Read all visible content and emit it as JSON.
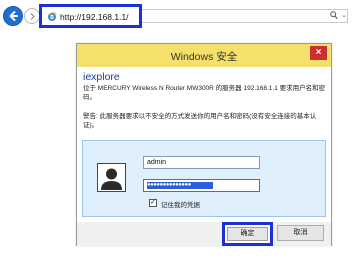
{
  "browser": {
    "url": "http://192.168.1.1/",
    "search_dropdown": "⌄",
    "icons": {
      "back": "back-arrow-icon",
      "forward": "forward-arrow-icon",
      "site": "ie-logo-icon",
      "search": "search-icon"
    },
    "colors": {
      "back_button": "#1f6fd1",
      "highlight_box": "#1d30d8"
    }
  },
  "dialog": {
    "title": "Windows 安全",
    "close_label": "×",
    "heading": "iexplore",
    "message": "位于 MERCURY Wireless N Router MW300R 的服务器 192.168.1.1 要求用户名和密码。",
    "warning": "警告: 此服务器要求以不安全的方式发送你的用户名和密码(没有安全连接的基本认证)。",
    "username_value": "admin",
    "password_masked": "●●●●●●●●●●●●●●",
    "remember_checked": "✓",
    "remember_label": "记住我的凭据",
    "ok_label": "确定",
    "cancel_label": "取消",
    "colors": {
      "titlebar": "#f5e06b",
      "close_button": "#c8312f",
      "panel": "#dfeffb",
      "heading": "#1b3f9a"
    },
    "icons": {
      "user": "user-avatar-icon",
      "close": "close-icon"
    }
  }
}
